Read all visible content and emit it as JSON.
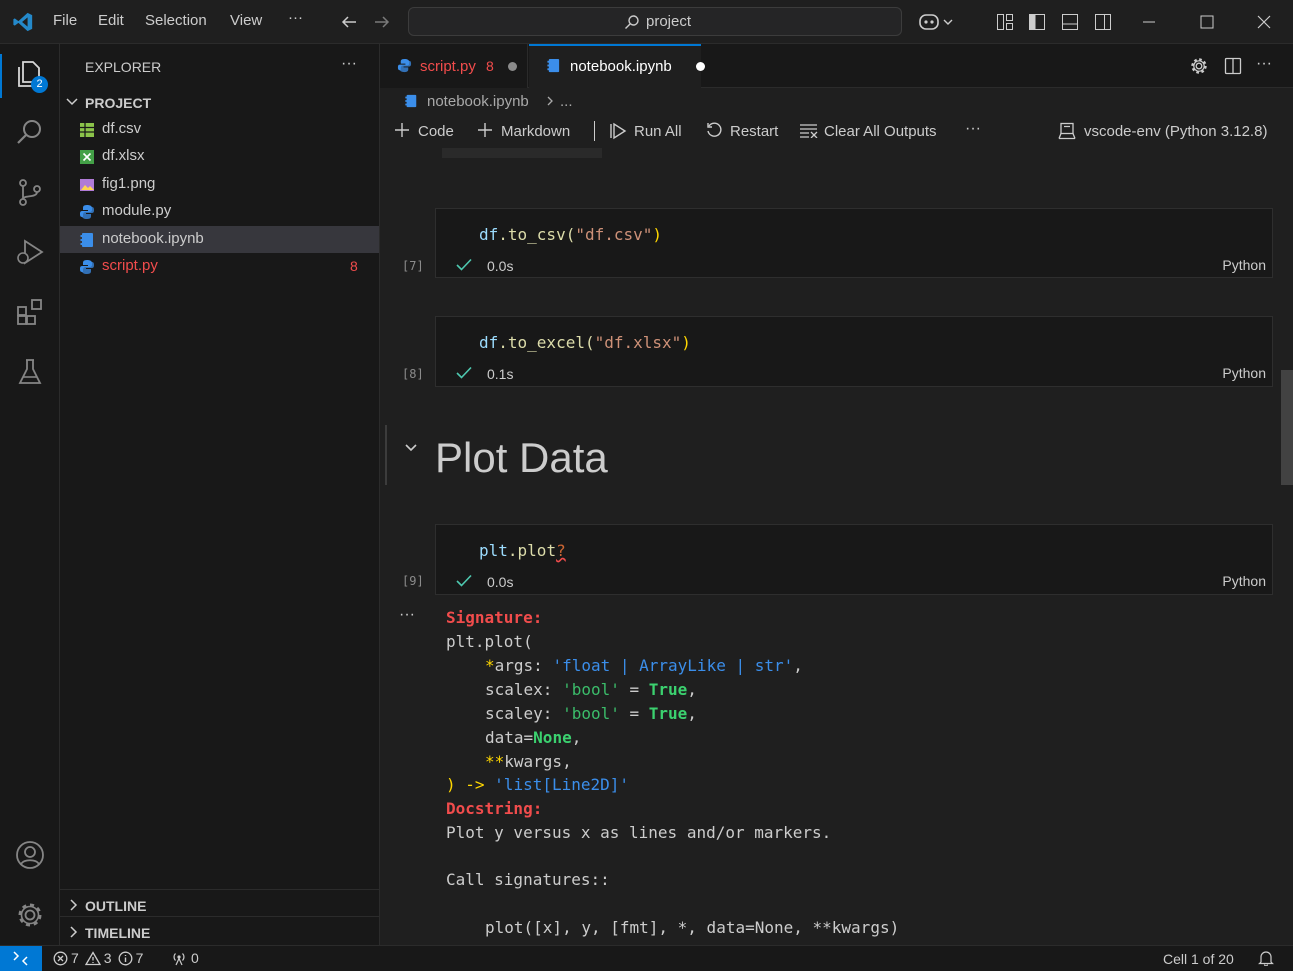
{
  "titlebar": {
    "menu": [
      "File",
      "Edit",
      "Selection",
      "View"
    ],
    "more": "···",
    "search": "project"
  },
  "activity": {
    "explorer_badge": "2"
  },
  "sidebar": {
    "title": "EXPLORER",
    "more": "···",
    "folder": "PROJECT",
    "files": [
      {
        "name": "df.csv",
        "icon": "table-icon",
        "color": "#8bc34a"
      },
      {
        "name": "df.xlsx",
        "icon": "excel-icon",
        "color": "#43a047"
      },
      {
        "name": "fig1.png",
        "icon": "image-icon",
        "color": "#b07bd6"
      },
      {
        "name": "module.py",
        "icon": "python-icon",
        "color": "#3b8eea"
      },
      {
        "name": "notebook.ipynb",
        "icon": "notebook-icon",
        "color": "#3b8eea"
      },
      {
        "name": "script.py",
        "icon": "python-icon",
        "color": "#f14c4c",
        "badge": "8"
      }
    ],
    "outline": "OUTLINE",
    "timeline": "TIMELINE"
  },
  "tabs": [
    {
      "label": "script.py",
      "count": "8",
      "modified": true,
      "active": false
    },
    {
      "label": "notebook.ipynb",
      "modified": true,
      "active": true
    }
  ],
  "breadcrumb": {
    "file": "notebook.ipynb",
    "more": "..."
  },
  "toolbar": {
    "code": "Code",
    "markdown": "Markdown",
    "run_all": "Run All",
    "restart": "Restart",
    "clear": "Clear All Outputs",
    "more": "···",
    "kernel": "vscode-env (Python 3.12.8)"
  },
  "cells": [
    {
      "exec": "[7]",
      "code_obj": "df",
      "code_fn": ".to_csv(",
      "code_str": "\"df.csv\"",
      "code_close": ")",
      "time": "0.0s",
      "lang": "Python"
    },
    {
      "exec": "[8]",
      "code_obj": "df",
      "code_fn": ".to_excel(",
      "code_str": "\"df.xlsx\"",
      "code_close": ")",
      "time": "0.1s",
      "lang": "Python"
    },
    {
      "exec": "[9]",
      "code_obj": "plt",
      "code_fn": ".plot",
      "code_str": "",
      "code_close": "?",
      "time": "0.0s",
      "lang": "Python"
    }
  ],
  "heading": "Plot Data",
  "output": {
    "more": "···",
    "signature_label": "Signature:",
    "sig_open": "plt.plot(",
    "args_star": "*",
    "args_name": "args: ",
    "args_type": "'float | ArrayLike | str'",
    "scalex_name": "scalex: ",
    "scalex_type": "'bool'",
    "scaley_name": "scaley: ",
    "scaley_type": "'bool'",
    "eq": " = ",
    "true": "True",
    "data_name": "data=",
    "none": "None",
    "kw_star": "**",
    "kw_name": "kwargs,",
    "ret": ") -> ",
    "ret_type": "'list[Line2D]'",
    "docstring_label": "Docstring:",
    "doc_line1": "Plot y versus x as lines and/or markers.",
    "doc_line2": "Call signatures::",
    "doc_line3": "plot([x], y, [fmt], *, data=None, **kwargs)"
  },
  "status": {
    "errors": "7",
    "warnings": "3",
    "info": "7",
    "ports": "0",
    "cell": "Cell 1 of 20"
  }
}
